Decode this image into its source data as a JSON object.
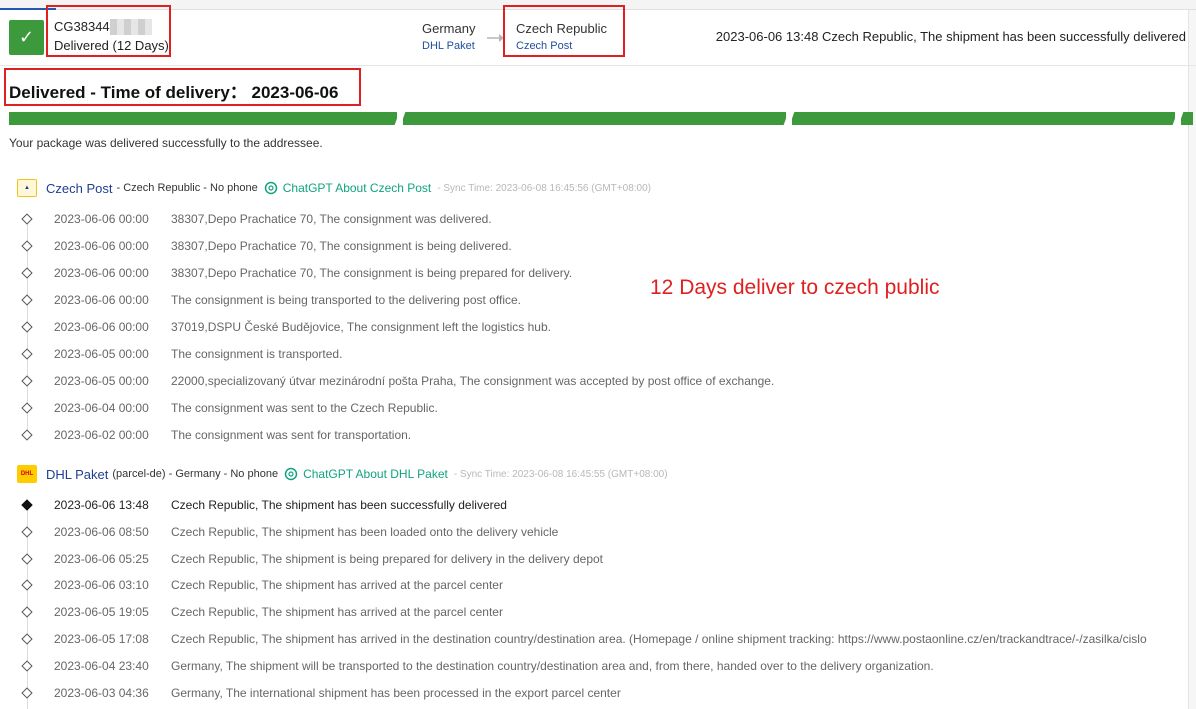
{
  "header": {
    "tracking_number": "CG38344",
    "status": "Delivered (12 Days)",
    "origin_country": "Germany",
    "origin_carrier": "DHL Paket",
    "destination_country": "Czech Republic",
    "destination_carrier": "Czech Post",
    "latest_event": "2023-06-06 13:48  Czech Republic, The shipment has been successfully delivered"
  },
  "delivery": {
    "title": "Delivered - Time of delivery：  2023-06-06",
    "message": "Your package was delivered successfully to the addressee."
  },
  "annotation": "12 Days deliver to czech public",
  "carriers": [
    {
      "name": "Czech Post",
      "meta": "- Czech Republic - No phone",
      "gpt_link": "ChatGPT About Czech Post",
      "sync_time": "- Sync Time: 2023-06-08 16:45:56 (GMT+08:00)",
      "events": [
        {
          "time": "2023-06-06 00:00",
          "desc": "38307,Depo Prachatice 70, The consignment was delivered."
        },
        {
          "time": "2023-06-06 00:00",
          "desc": "38307,Depo Prachatice 70, The consignment is being delivered."
        },
        {
          "time": "2023-06-06 00:00",
          "desc": "38307,Depo Prachatice 70, The consignment is being prepared for delivery."
        },
        {
          "time": "2023-06-06 00:00",
          "desc": "The consignment is being transported to the delivering post office."
        },
        {
          "time": "2023-06-06 00:00",
          "desc": "37019,DSPU České Budějovice, The consignment left the logistics hub."
        },
        {
          "time": "2023-06-05 00:00",
          "desc": "The consignment is transported."
        },
        {
          "time": "2023-06-05 00:00",
          "desc": "22000,specializovaný útvar mezinárodní pošta Praha, The consignment was accepted by post office of exchange."
        },
        {
          "time": "2023-06-04 00:00",
          "desc": "The consignment was sent to the Czech Republic."
        },
        {
          "time": "2023-06-02 00:00",
          "desc": "The consignment was sent for transportation."
        }
      ]
    },
    {
      "name": "DHL Paket",
      "meta": "(parcel-de) - Germany - No phone",
      "gpt_link": "ChatGPT About DHL Paket",
      "sync_time": "- Sync Time: 2023-06-08 16:45:55 (GMT+08:00)",
      "events": [
        {
          "time": "2023-06-06 13:48",
          "desc": "Czech Republic, The shipment has been successfully delivered"
        },
        {
          "time": "2023-06-06 08:50",
          "desc": "Czech Republic, The shipment has been loaded onto the delivery vehicle"
        },
        {
          "time": "2023-06-06 05:25",
          "desc": "Czech Republic, The shipment is being prepared for delivery in the delivery depot"
        },
        {
          "time": "2023-06-06 03:10",
          "desc": "Czech Republic, The shipment has arrived at the parcel center"
        },
        {
          "time": "2023-06-05 19:05",
          "desc": "Czech Republic, The shipment has arrived at the parcel center"
        },
        {
          "time": "2023-06-05 17:08",
          "desc": "Czech Republic, The shipment has arrived in the destination country/destination area. (Homepage / online shipment tracking: https://www.postaonline.cz/en/trackandtrace/-/zasilka/cislo"
        },
        {
          "time": "2023-06-04 23:40",
          "desc": "Germany, The shipment will be transported to the destination country/destination area and, from there, handed over to the delivery organization."
        },
        {
          "time": "2023-06-03 04:36",
          "desc": "Germany, The international shipment has been processed in the export parcel center"
        }
      ]
    }
  ],
  "colors": {
    "accent_green": "#3c9a3c",
    "highlight_red": "#e02020",
    "link_blue": "#1f3f8f",
    "gpt_green": "#10a37f"
  },
  "icons": {
    "status": "check-icon",
    "route": "arrow-right-icon",
    "gpt": "openai-icon"
  }
}
